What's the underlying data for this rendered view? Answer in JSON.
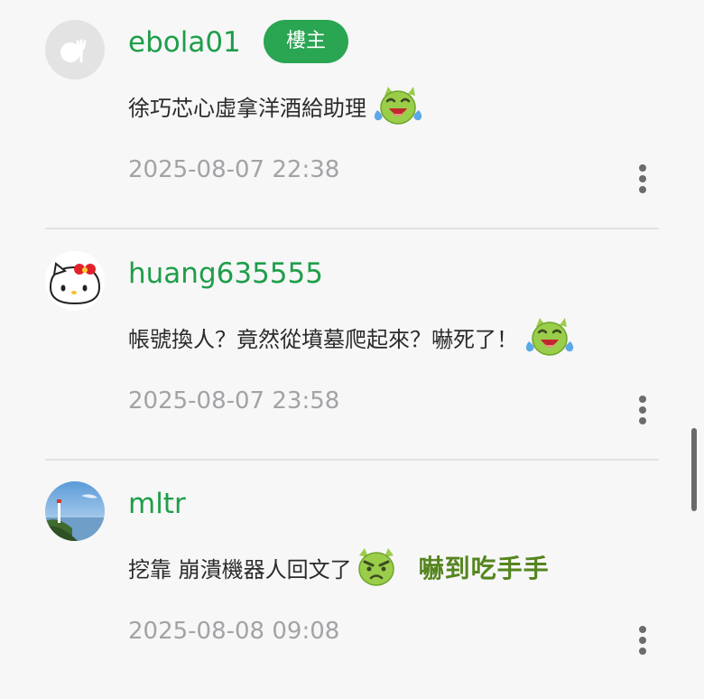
{
  "comments": [
    {
      "username": "ebola01",
      "badge": "樓主",
      "text": "徐巧芯心虛拿洋酒給助理",
      "emoji": "crying-laughing-face",
      "sticker_text": "",
      "timestamp": "2025-08-07 22:38",
      "avatar": "default-gray"
    },
    {
      "username": "huang635555",
      "badge": "",
      "text": "帳號換人？竟然從墳墓爬起來？嚇死了！",
      "emoji": "crying-laughing-face",
      "sticker_text": "",
      "timestamp": "2025-08-07 23:58",
      "avatar": "hello-kitty"
    },
    {
      "username": "mltr",
      "badge": "",
      "text": "挖靠 崩潰機器人回文了",
      "emoji": "angry-face",
      "sticker_text": "嚇到吃手手",
      "timestamp": "2025-08-08 09:08",
      "avatar": "landscape-lighthouse"
    }
  ],
  "colors": {
    "username": "#1e9e4a",
    "badge_bg": "#2aa552",
    "timestamp": "#a3a3a7",
    "emoji_green": "#9acd4a",
    "background": "#f7f7f7"
  }
}
